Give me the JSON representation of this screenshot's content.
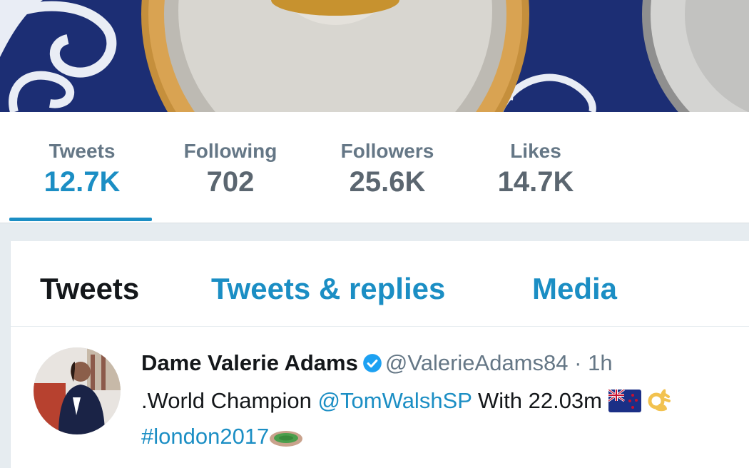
{
  "stats": [
    {
      "label": "Tweets",
      "value": "12.7K",
      "active": true
    },
    {
      "label": "Following",
      "value": "702",
      "active": false
    },
    {
      "label": "Followers",
      "value": "25.6K",
      "active": false
    },
    {
      "label": "Likes",
      "value": "14.7K",
      "active": false
    }
  ],
  "tabs": [
    {
      "label": "Tweets",
      "active": true
    },
    {
      "label": "Tweets & replies",
      "active": false
    },
    {
      "label": "Media",
      "active": false
    }
  ],
  "tweet": {
    "display_name": "Dame Valerie Adams",
    "handle": "@ValerieAdams84",
    "separator": "·",
    "time": "1h",
    "text_prefix": ".World Champion",
    "mention": "@TomWalshSP",
    "text_suffix": "With 22.03m",
    "hashtag": "#london2017",
    "emojis": [
      "new-zealand-flag-icon",
      "ok-hand-icon",
      "stadium-icon"
    ]
  },
  "colors": {
    "accent": "#1b8ec4",
    "text": "#14171a",
    "muted": "#657786",
    "banner_blue": "#1c2e74",
    "medal_gold": "#c58f3c"
  }
}
